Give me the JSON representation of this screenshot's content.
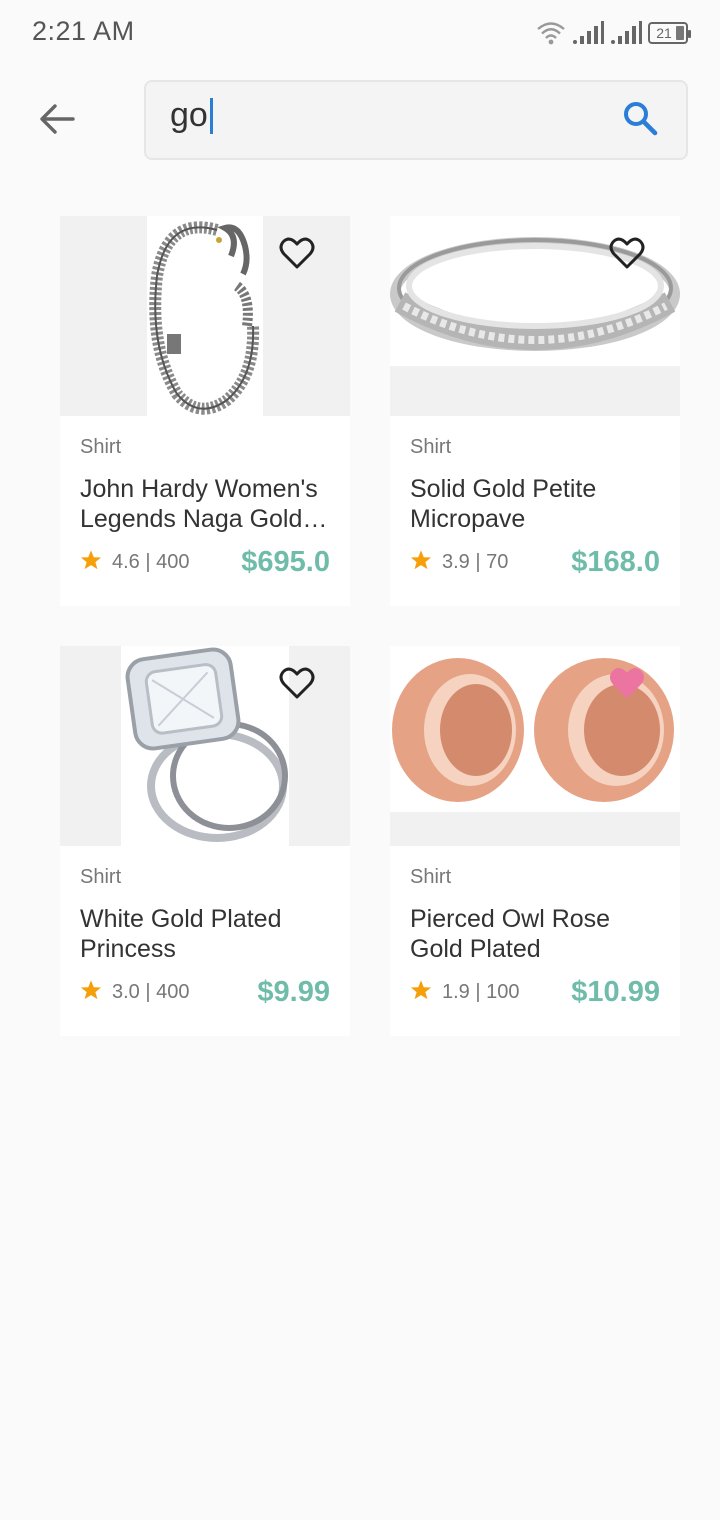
{
  "status_bar": {
    "time": "2:21 AM",
    "battery": "21",
    "icons": [
      "wifi-icon",
      "signal-icon",
      "signal-icon",
      "battery-icon"
    ]
  },
  "header": {
    "back_icon": "arrow-back-icon",
    "search": {
      "value": "go",
      "icon": "search-icon",
      "accent_color": "#2a7ed8"
    }
  },
  "colors": {
    "price": "#6fbcaa",
    "star": "#f5a00a",
    "heart_active": "#ec74a0",
    "heart_outline": "#222222"
  },
  "products": [
    {
      "category": "Shirt",
      "title": "John Hardy Women's Legends Naga Gold…",
      "rating": "4.6",
      "reviews": "400",
      "rating_text": "4.6 | 400",
      "price": "$695.0",
      "favorited": false,
      "image": "bracelet-image"
    },
    {
      "category": "Shirt",
      "title": "Solid Gold Petite Micropave",
      "rating": "3.9",
      "reviews": "70",
      "rating_text": "3.9 | 70",
      "price": "$168.0",
      "favorited": false,
      "image": "band-ring-image"
    },
    {
      "category": "Shirt",
      "title": "White Gold Plated Princess",
      "rating": "3.0",
      "reviews": "400",
      "rating_text": "3.0 | 400",
      "price": "$9.99",
      "favorited": false,
      "image": "engagement-ring-image"
    },
    {
      "category": "Shirt",
      "title": "Pierced Owl Rose Gold Plated Stainles…",
      "rating": "1.9",
      "reviews": "100",
      "rating_text": "1.9 | 100",
      "price": "$10.99",
      "favorited": true,
      "image": "ear-tunnels-image"
    }
  ]
}
